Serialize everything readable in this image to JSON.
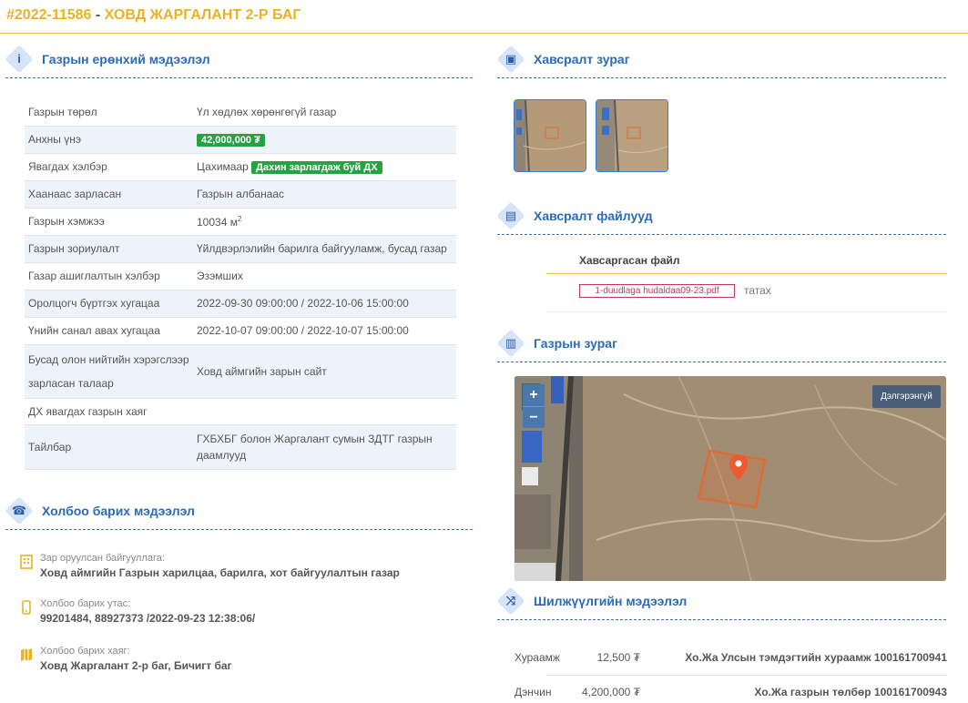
{
  "header": {
    "number": "#2022-11586",
    "dash": " - ",
    "name": "ХОВД ЖАРГАЛАНТ 2-Р БАГ"
  },
  "sections": {
    "general": "Газрын ерөнхий мэдээлэл",
    "contact": "Холбоо барих мэдээлэл",
    "image": "Хавсралт зураг",
    "files": "Хавсралт файлууд",
    "map": "Газрын зураг",
    "transfer": "Шилжүүлгийн мэдээлэл"
  },
  "info_rows": [
    {
      "key": "Газрын төрөл",
      "value": "Үл хөдлөх хөрөнгөгүй газар"
    },
    {
      "key": "Анхны үнэ",
      "value": "42,000,000 ₮"
    },
    {
      "key": "Явагдах хэлбэр",
      "value": "Цахимаар",
      "badge": "Дахин зарлагдаж буй ДХ"
    },
    {
      "key": "Хаанаас зарласан",
      "value": "Газрын албанаас"
    },
    {
      "key": "Газрын хэмжээ",
      "value": "10034 м",
      "sup": "2"
    },
    {
      "key": "Газрын зориулалт",
      "value": "Үйлдвэрлэлийн барилга байгууламж, бусад газар"
    },
    {
      "key": "Газар ашиглалтын хэлбэр",
      "value": "Эзэмших"
    },
    {
      "key": "Оролцогч бүртгэх хугацаа",
      "value": "2022-09-30 09:00:00 / 2022-10-06 15:00:00"
    },
    {
      "key": "Үнийн санал авах хугацаа",
      "value": "2022-10-07 09:00:00 / 2022-10-07 15:00:00"
    },
    {
      "key": "Бусад олон нийтийн хэрэгслээр зарласан талаар",
      "value": "Ховд аймгийн зарын сайт"
    },
    {
      "key": "ДХ явагдах газрын хаяг",
      "value": ""
    },
    {
      "key": "Тайлбар",
      "value": "ГХБХБГ болон Жаргалант сумын ЗДТГ газрын даамлууд"
    }
  ],
  "contact": {
    "org_label": "Зар оруулсан байгууллага:",
    "org_value": "Ховд аймгийн Газрын харилцаа, барилга, хот байгуулалтын газар",
    "phone_label": "Холбоо барих утас:",
    "phone_value": "99201484, 88927373 /2022-09-23 12:38:06/",
    "address_label": "Холбоо барих хаяг:",
    "address_value": "Ховд Жаргалант 2-р баг, Бичигт баг"
  },
  "files": {
    "header": "Хавсаргасан файл",
    "file_name": "1-duudlaga hudaldaa09-23.pdf",
    "download": "татах"
  },
  "map": {
    "zoom_in": "+",
    "zoom_out": "−",
    "detail": "Дэлгэрэнгүй"
  },
  "transfers": [
    {
      "name": "Хураамж",
      "amount": "12,500 ₮",
      "desc": "Хо.Жа Улсын тэмдэгтийн хураамж 100161700941"
    },
    {
      "name": "Дэнчин",
      "amount": "4,200,000 ₮",
      "desc": "Хо.Жа газрын төлбөр 100161700943"
    }
  ],
  "colors": {
    "accent": "#e8b321",
    "heading": "#2a6bb8",
    "badge": "#27a243",
    "file": "#c0395a"
  },
  "icons": {
    "general": "info-icon",
    "contact": "phone-icon",
    "image": "image-icon",
    "files": "file-icon",
    "map": "map-icon",
    "transfer": "shuffle-icon"
  }
}
